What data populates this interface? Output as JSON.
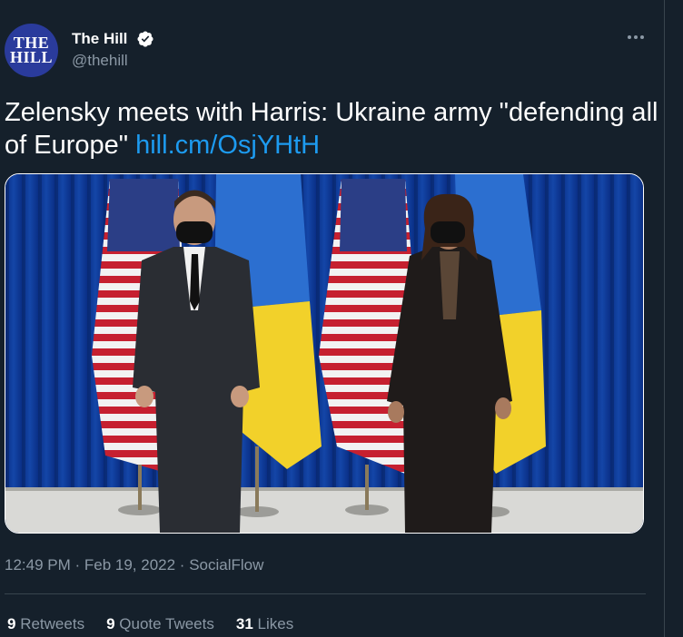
{
  "account": {
    "avatar_line1": "THE",
    "avatar_line2": "HILL",
    "display_name": "The Hill",
    "handle": "@thehill"
  },
  "tweet": {
    "text": "Zelensky meets with Harris: Ukraine army \"defending all of Europe\" ",
    "link": "hill.cm/OsjYHtH",
    "time": "12:49 PM",
    "date": "Feb 19, 2022",
    "source": "SocialFlow",
    "separator": " · "
  },
  "stats": [
    {
      "count": "9",
      "label": "Retweets"
    },
    {
      "count": "9",
      "label": "Quote Tweets"
    },
    {
      "count": "31",
      "label": "Likes"
    }
  ],
  "colors": {
    "background": "#15202b",
    "link": "#1d9bf0",
    "secondary_text": "#8b98a5",
    "avatar_blue": "#2a3b9c"
  },
  "icons": {
    "verified": "verified-badge-icon",
    "more": "more-options-icon"
  }
}
